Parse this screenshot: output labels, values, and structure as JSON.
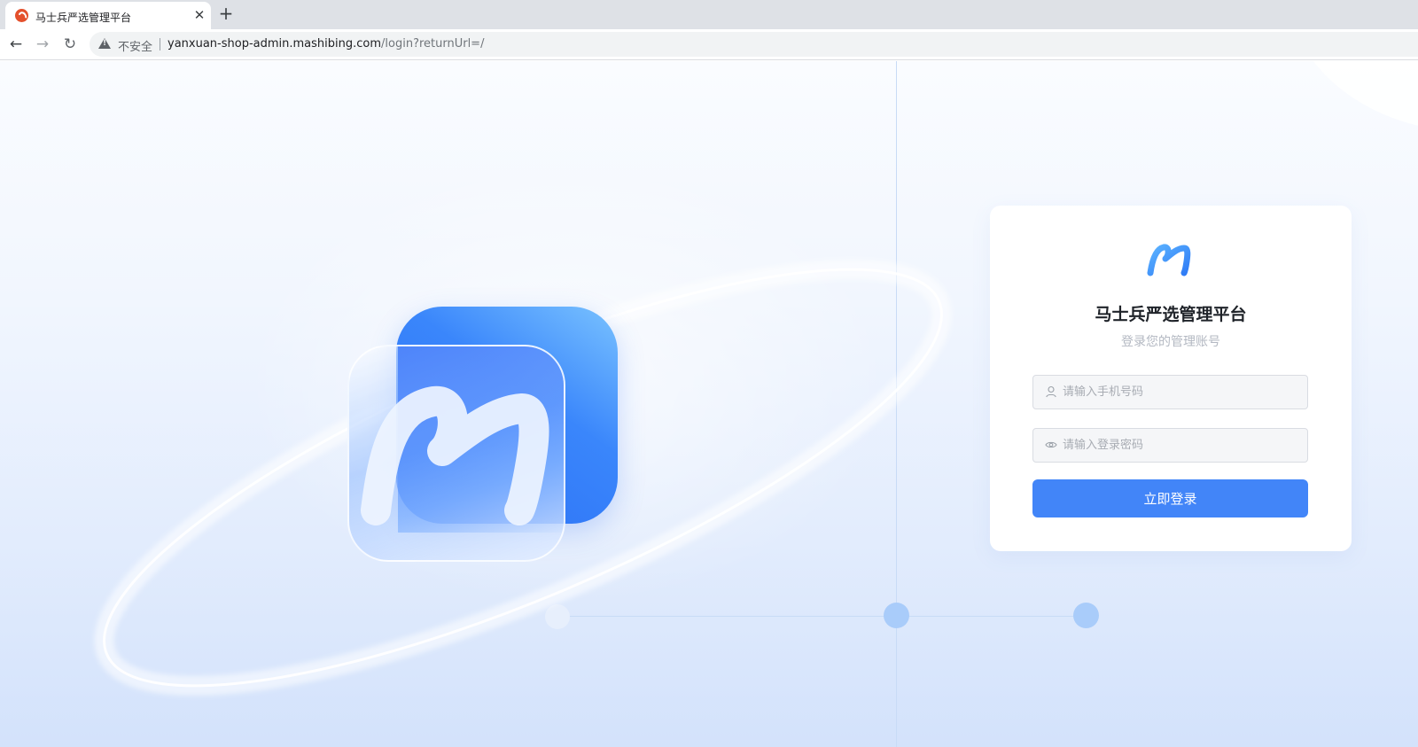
{
  "browser": {
    "tab": {
      "title": "马士兵严选管理平台",
      "close_symbol": "✕",
      "favicon_icon": "mashibing-favicon"
    },
    "new_tab_symbol": "+",
    "nav": {
      "back_symbol": "←",
      "forward_symbol": "→",
      "reload_symbol": "↻"
    },
    "address_bar": {
      "security_icon": "warning-icon",
      "security_label": "不安全",
      "url_host": "yanxuan-shop-admin.mashibing.com",
      "url_path": "/login?returnUrl=/"
    }
  },
  "login": {
    "title": "马士兵严选管理平台",
    "subtitle": "登录您的管理账号",
    "phone_placeholder": "请输入手机号码",
    "phone_value": "",
    "password_placeholder": "请输入登录密码",
    "password_value": "",
    "submit_label": "立即登录"
  },
  "colors": {
    "accent": "#4285f8",
    "logo_blue": "#3a86fb",
    "background_light": "#f1f6fe",
    "tab_bar": "#dee1e6"
  },
  "icons": {
    "brand_logo": "m-logo-icon",
    "phone_field": "user-icon",
    "password_field": "eye-icon"
  }
}
